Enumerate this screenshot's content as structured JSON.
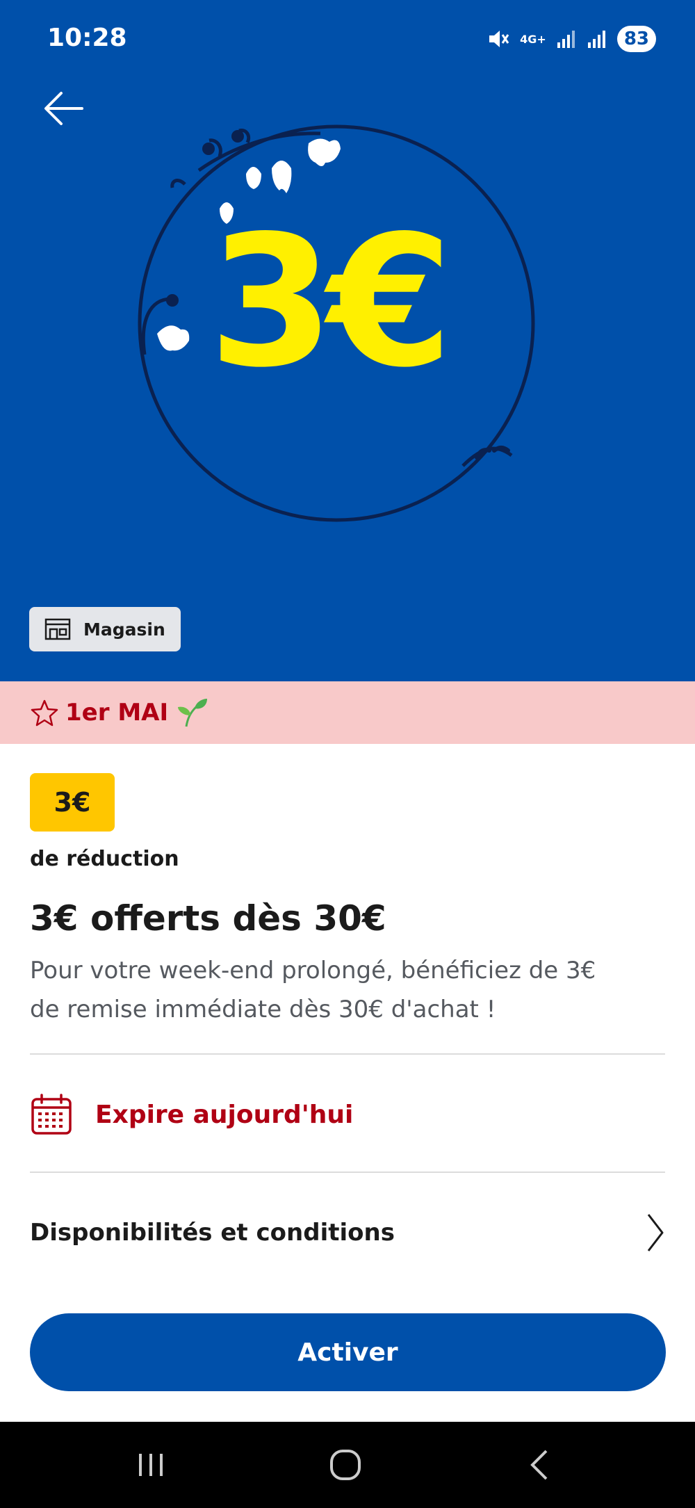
{
  "status_bar": {
    "time": "10:28",
    "network": "4G+",
    "battery": "83"
  },
  "hero": {
    "amount": "3€",
    "channel_badge": "Magasin",
    "background_color": "#0050AA",
    "amount_color": "#FFF000"
  },
  "ribbon": {
    "label": "1er MAI",
    "background_color": "#F8C9C9"
  },
  "offer": {
    "price_badge": "3€",
    "discount_type": "de réduction",
    "title": "3€ offerts dès 30€",
    "description_line1": "Pour votre week-end prolongé, bénéficiez de 3€",
    "description_line2": "de remise immédiate dès 30€ d'achat !"
  },
  "expiry": {
    "label": "Expire aujourd'hui",
    "color": "#B00014"
  },
  "conditions": {
    "label": "Disponibilités et conditions"
  },
  "cta": {
    "label": "Activer"
  },
  "icons": [
    "back-arrow-icon",
    "store-icon",
    "star-icon",
    "sprout-icon",
    "calendar-icon",
    "chevron-right-icon",
    "recents-icon",
    "home-icon",
    "nav-back-icon",
    "mute-icon",
    "signal-icon"
  ]
}
